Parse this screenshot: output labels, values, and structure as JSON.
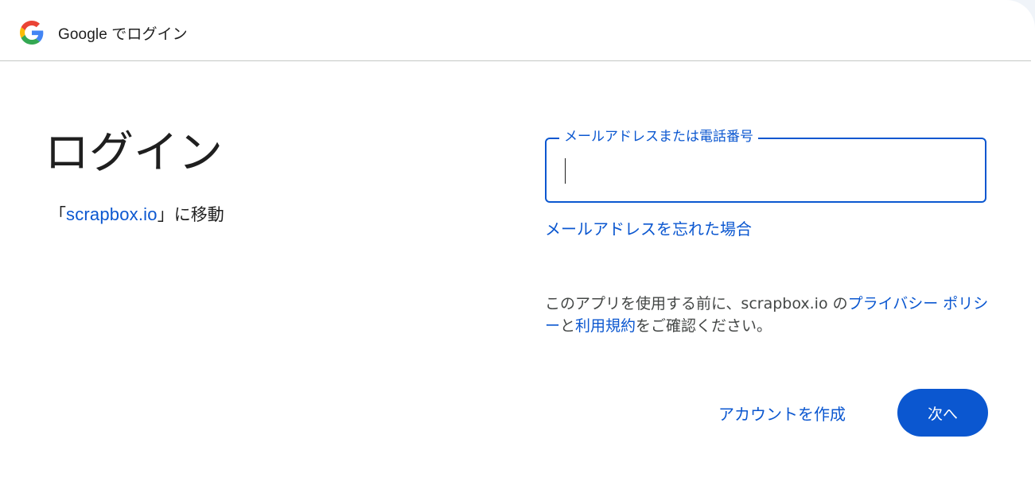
{
  "header": {
    "title": "Google でログイン"
  },
  "main": {
    "title": "ログイン",
    "subtitle_prefix": "「",
    "subtitle_link": "scrapbox.io",
    "subtitle_suffix": "」に移動"
  },
  "form": {
    "email_label": "メールアドレスまたは電話番号",
    "email_value": "",
    "forgot_email": "メールアドレスを忘れた場合"
  },
  "notice": {
    "prefix": "このアプリを使用する前に、scrapbox.io の",
    "privacy_link": "プライバシー ポリシー",
    "middle": "と",
    "terms_link": "利用規約",
    "suffix": "をご確認ください。"
  },
  "actions": {
    "create_account": "アカウントを作成",
    "next": "次へ"
  },
  "colors": {
    "accent": "#0b57d0",
    "text": "#1f1f1f",
    "muted": "#444746"
  }
}
